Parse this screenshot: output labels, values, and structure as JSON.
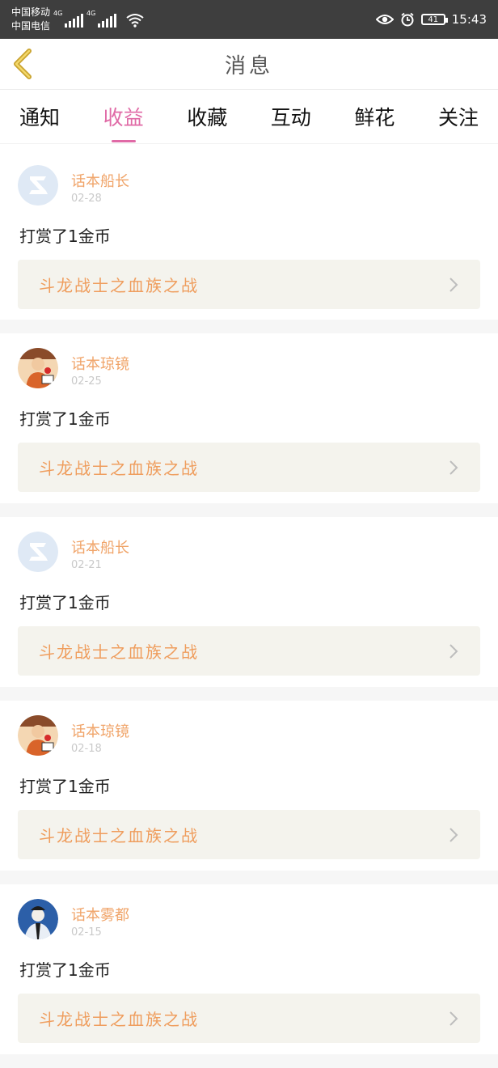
{
  "status": {
    "carrier1": "中国移动",
    "carrier2": "中国电信",
    "net1": "4G",
    "net2": "4G",
    "battery": "41",
    "time": "15:43"
  },
  "header": {
    "title": "消息"
  },
  "tabs": [
    {
      "label": "通知"
    },
    {
      "label": "收益"
    },
    {
      "label": "收藏"
    },
    {
      "label": "互动"
    },
    {
      "label": "鲜花"
    },
    {
      "label": "关注"
    }
  ],
  "active_tab": "收益",
  "messages": [
    {
      "user": "话本船长",
      "date": "02-28",
      "action": "打赏了1金币",
      "book": "斗龙战士之血族之战",
      "avatar": "qq-default"
    },
    {
      "user": "话本琼镜",
      "date": "02-25",
      "action": "打赏了1金币",
      "book": "斗龙战士之血族之战",
      "avatar": "photo-red"
    },
    {
      "user": "话本船长",
      "date": "02-21",
      "action": "打赏了1金币",
      "book": "斗龙战士之血族之战",
      "avatar": "qq-default"
    },
    {
      "user": "话本琼镜",
      "date": "02-18",
      "action": "打赏了1金币",
      "book": "斗龙战士之血族之战",
      "avatar": "photo-red"
    },
    {
      "user": "话本雾都",
      "date": "02-15",
      "action": "打赏了1金币",
      "book": "斗龙战士之血族之战",
      "avatar": "photo-blue"
    }
  ],
  "colors": {
    "accent": "#e06aa6",
    "username": "#f0a469",
    "book_title": "#ef9d5d"
  }
}
